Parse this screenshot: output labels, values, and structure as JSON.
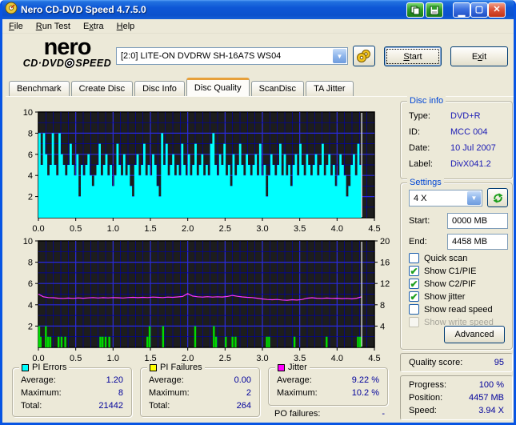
{
  "window": {
    "title": "Nero CD-DVD Speed 4.7.5.0"
  },
  "menu": [
    {
      "pre": "",
      "accel": "F",
      "post": "ile"
    },
    {
      "pre": "",
      "accel": "R",
      "post": "un Test"
    },
    {
      "pre": "E",
      "accel": "x",
      "post": "tra"
    },
    {
      "pre": "",
      "accel": "H",
      "post": "elp"
    }
  ],
  "logo": {
    "line1": "nero",
    "line2_left": "CD·DVD",
    "line2_right": "SPEED"
  },
  "drive_select": {
    "value": "[2:0]   LITE-ON DVDRW SH-16A7S WS04"
  },
  "buttons": {
    "start": {
      "pre": "",
      "accel": "S",
      "post": "tart"
    },
    "exit": {
      "pre": "E",
      "accel": "x",
      "post": "it"
    }
  },
  "tabs": [
    {
      "label": "Benchmark",
      "active": false
    },
    {
      "label": "Create Disc",
      "active": false
    },
    {
      "label": "Disc Info",
      "active": false
    },
    {
      "label": "Disc Quality",
      "active": true
    },
    {
      "label": "ScanDisc",
      "active": false
    },
    {
      "label": "TA Jitter",
      "active": false
    }
  ],
  "disc_info": {
    "caption": "Disc info",
    "rows": [
      {
        "label": "Type:",
        "value": "DVD+R"
      },
      {
        "label": "ID:",
        "value": "MCC 004"
      },
      {
        "label": "Date:",
        "value": "10 Jul 2007"
      },
      {
        "label": "Label:",
        "value": "DivX041.2"
      }
    ]
  },
  "settings": {
    "caption": "Settings",
    "speed_value": "4 X",
    "start_label": "Start:",
    "start_value": "0000 MB",
    "end_label": "End:",
    "end_value": "4458 MB",
    "checkboxes": [
      {
        "label": "Quick scan",
        "checked": false,
        "disabled": false
      },
      {
        "label": "Show C1/PIE",
        "checked": true,
        "disabled": false
      },
      {
        "label": "Show C2/PIF",
        "checked": true,
        "disabled": false
      },
      {
        "label": "Show jitter",
        "checked": true,
        "disabled": false
      },
      {
        "label": "Show read speed",
        "checked": false,
        "disabled": false
      },
      {
        "label": "Show write speed",
        "checked": false,
        "disabled": true
      }
    ],
    "advanced_label": "Advanced"
  },
  "quality": {
    "label": "Quality score:",
    "value": "95"
  },
  "progress_panel": {
    "rows": [
      {
        "label": "Progress:",
        "value": "100 %"
      },
      {
        "label": "Position:",
        "value": "4457 MB"
      },
      {
        "label": "Speed:",
        "value": "3.94 X"
      }
    ]
  },
  "stats": {
    "pi_errors": {
      "caption": "PI Errors",
      "legend_color": "#00FFFF",
      "rows": [
        {
          "label": "Average:",
          "value": "1.20"
        },
        {
          "label": "Maximum:",
          "value": "8"
        },
        {
          "label": "Total:",
          "value": "21442"
        }
      ]
    },
    "pi_failures": {
      "caption": "PI Failures",
      "legend_color": "#FFFF00",
      "rows": [
        {
          "label": "Average:",
          "value": "0.00"
        },
        {
          "label": "Maximum:",
          "value": "2"
        },
        {
          "label": "Total:",
          "value": "264"
        }
      ]
    },
    "jitter": {
      "caption": "Jitter",
      "legend_color": "#FF00FF",
      "rows": [
        {
          "label": "Average:",
          "value": "9.22 %"
        },
        {
          "label": "Maximum:",
          "value": "10.2 %"
        }
      ]
    },
    "po_failures": {
      "label": "PO failures:",
      "value": "-"
    }
  },
  "chart_data": [
    {
      "type": "area",
      "title": "PI Errors scan",
      "xlim": [
        0,
        4.5
      ],
      "ylim_left": [
        0,
        10
      ],
      "xticks": [
        0,
        0.5,
        1,
        1.5,
        2,
        2.5,
        3,
        3.5,
        4,
        4.5
      ],
      "yticks_left": [
        2,
        4,
        6,
        8,
        10
      ],
      "grid": {
        "x_minor": 0.1,
        "x_major": 0.5,
        "y_minor": 1,
        "y_major": 2
      },
      "marker_x": 4.33,
      "area": {
        "name": "PI Errors",
        "color": "#00FFFF",
        "x_end": 4.33,
        "values": [
          8,
          5,
          8,
          6,
          4,
          5,
          8,
          5,
          4,
          8,
          6,
          5,
          4,
          5,
          7,
          5,
          4,
          6,
          2,
          5,
          4,
          5,
          6,
          4,
          3,
          4,
          5,
          7,
          4,
          5,
          6,
          4,
          5,
          3,
          4,
          7,
          5,
          4,
          6,
          4,
          5,
          3,
          2,
          5,
          6,
          4,
          5,
          7,
          4,
          5,
          4,
          6,
          5,
          3,
          2,
          8,
          5,
          7,
          4,
          5,
          6,
          4,
          5,
          4,
          7,
          5,
          4,
          6,
          4,
          5,
          7,
          4,
          5,
          6,
          4,
          5,
          4,
          7,
          8,
          5,
          4,
          6,
          5,
          7,
          4,
          5,
          3,
          6,
          4,
          5,
          7,
          5,
          4,
          6,
          5,
          4,
          5,
          6,
          4,
          7,
          4,
          5,
          2,
          4,
          6,
          5,
          4,
          5,
          7,
          4,
          6,
          4,
          5,
          3,
          5,
          6,
          4,
          7,
          5,
          4,
          6,
          5,
          4,
          5,
          6,
          4,
          5,
          7,
          4,
          5,
          6,
          4,
          5,
          3,
          4,
          6,
          5,
          4,
          2,
          3,
          5,
          6,
          4,
          7,
          5
        ]
      }
    },
    {
      "type": "mixed",
      "title": "PI Failures and Jitter scan",
      "xlim": [
        0,
        4.5
      ],
      "ylim_left": [
        0,
        10
      ],
      "ylim_right": [
        0,
        20
      ],
      "xticks": [
        0,
        0.5,
        1,
        1.5,
        2,
        2.5,
        3,
        3.5,
        4,
        4.5
      ],
      "yticks_left": [
        2,
        4,
        6,
        8,
        10
      ],
      "yticks_right": [
        4,
        8,
        12,
        16,
        20
      ],
      "grid": {
        "x_minor": 0.1,
        "x_major": 0.5,
        "y_minor": 1,
        "y_major": 2
      },
      "marker_x": 4.33,
      "bars": {
        "name": "PI Failures",
        "color": "#00DC00",
        "points": [
          [
            0.01,
            2
          ],
          [
            0.03,
            1
          ],
          [
            0.1,
            2
          ],
          [
            0.13,
            1
          ],
          [
            0.16,
            1
          ],
          [
            0.27,
            1
          ],
          [
            0.31,
            1
          ],
          [
            0.36,
            1
          ],
          [
            0.83,
            1
          ],
          [
            0.86,
            1
          ],
          [
            0.9,
            1
          ],
          [
            0.95,
            1
          ],
          [
            1.46,
            1
          ],
          [
            1.49,
            2
          ],
          [
            1.67,
            2
          ],
          [
            2.1,
            2
          ],
          [
            2.35,
            2
          ],
          [
            2.38,
            1
          ],
          [
            2.51,
            1
          ],
          [
            2.6,
            1
          ],
          [
            2.64,
            1
          ],
          [
            3.06,
            1
          ],
          [
            3.09,
            1
          ],
          [
            3.43,
            1
          ],
          [
            3.86,
            1
          ],
          [
            4.28,
            1
          ],
          [
            4.31,
            1
          ]
        ]
      },
      "line": {
        "name": "Jitter",
        "color": "#FF35FF",
        "x_end": 4.33,
        "values": [
          5.0,
          4.75,
          4.68,
          4.66,
          4.62,
          4.6,
          4.63,
          4.6,
          4.65,
          4.62,
          4.65,
          4.68,
          4.64,
          4.67,
          4.65,
          4.68,
          4.66,
          4.64,
          4.68,
          4.7,
          4.67,
          4.7,
          4.68,
          4.72,
          4.7,
          4.68,
          4.72,
          4.7,
          4.74,
          4.78,
          5.05,
          4.82,
          4.75,
          4.72,
          4.76,
          4.72,
          4.75,
          4.73,
          4.78,
          4.88,
          4.8,
          4.74,
          4.7,
          4.68,
          4.62,
          4.55,
          4.5,
          4.47,
          4.5,
          4.45,
          4.43,
          4.47,
          4.44,
          4.5,
          4.62,
          4.66,
          4.62,
          4.6,
          4.63,
          4.6,
          4.62,
          4.58,
          4.6,
          4.56,
          4.62,
          4.75
        ]
      }
    }
  ],
  "colors": {
    "plot_bg": "#1D1D1D",
    "grid_minor": "#0000A6",
    "grid_major": "#2A2ADF",
    "marker": "#D9D9D9"
  }
}
